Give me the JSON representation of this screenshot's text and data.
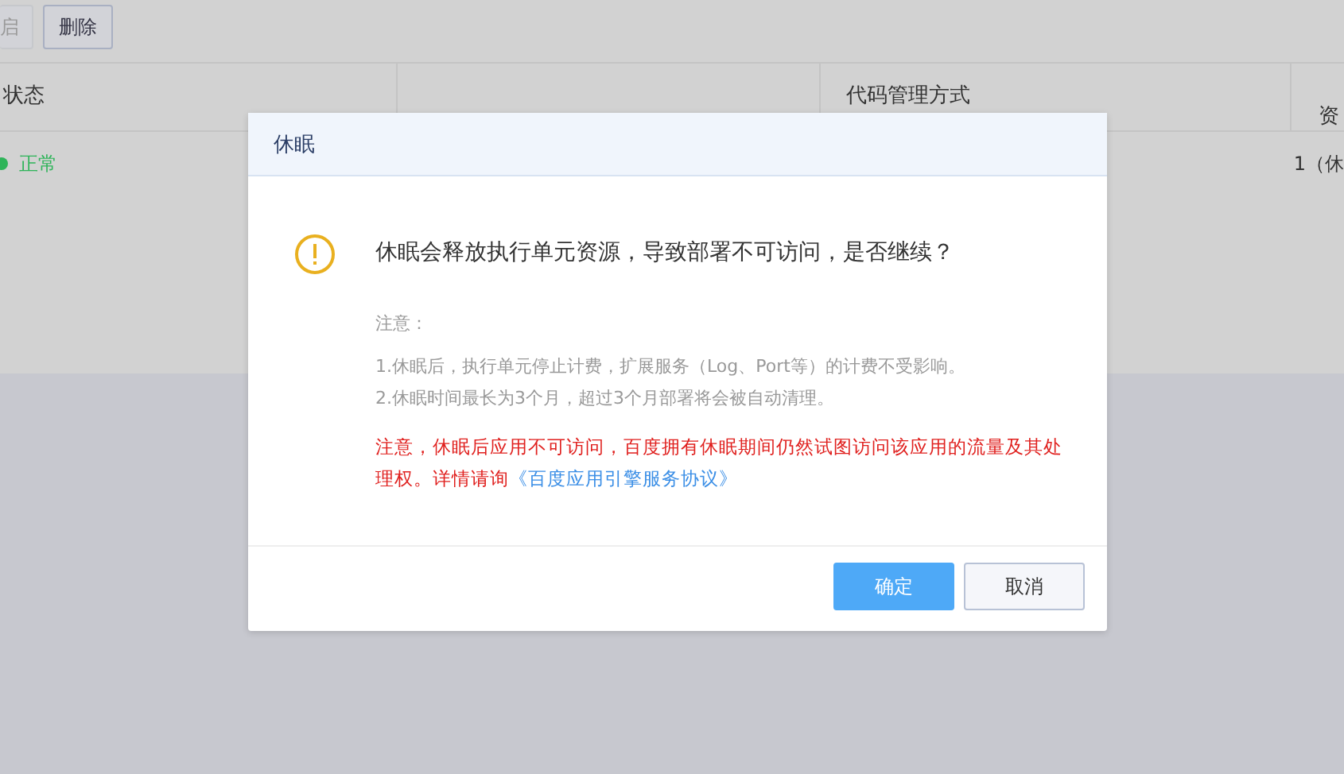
{
  "toolbar": {
    "buttons": [
      {
        "label": "启",
        "kind": "cut"
      },
      {
        "label": "删除",
        "kind": "normal"
      }
    ]
  },
  "table": {
    "columns": [
      {
        "label": "状态"
      },
      {
        "label": "代码管理方式"
      },
      {
        "label": "资"
      }
    ],
    "rows": [
      {
        "status": "正常",
        "column_4": "1（休"
      }
    ]
  },
  "dialog": {
    "title": "休眠",
    "question": "休眠会释放执行单元资源，导致部署不可访问，是否继续？",
    "note_title": "注意：",
    "notes": [
      "1.休眠后，执行单元停止计费，扩展服务（Log、Port等）的计费不受影响。",
      "2.休眠时间最长为3个月，超过3个月部署将会被自动清理。"
    ],
    "warning": "注意，休眠后应用不可访问，百度拥有休眠期间仍然试图访问该应用的流量及其处理权。详情请询",
    "link": "《百度应用引擎服务协议》",
    "buttons": [
      {
        "label": "确定",
        "kind": "primary"
      },
      {
        "label": "取消",
        "kind": "secondary"
      }
    ]
  }
}
